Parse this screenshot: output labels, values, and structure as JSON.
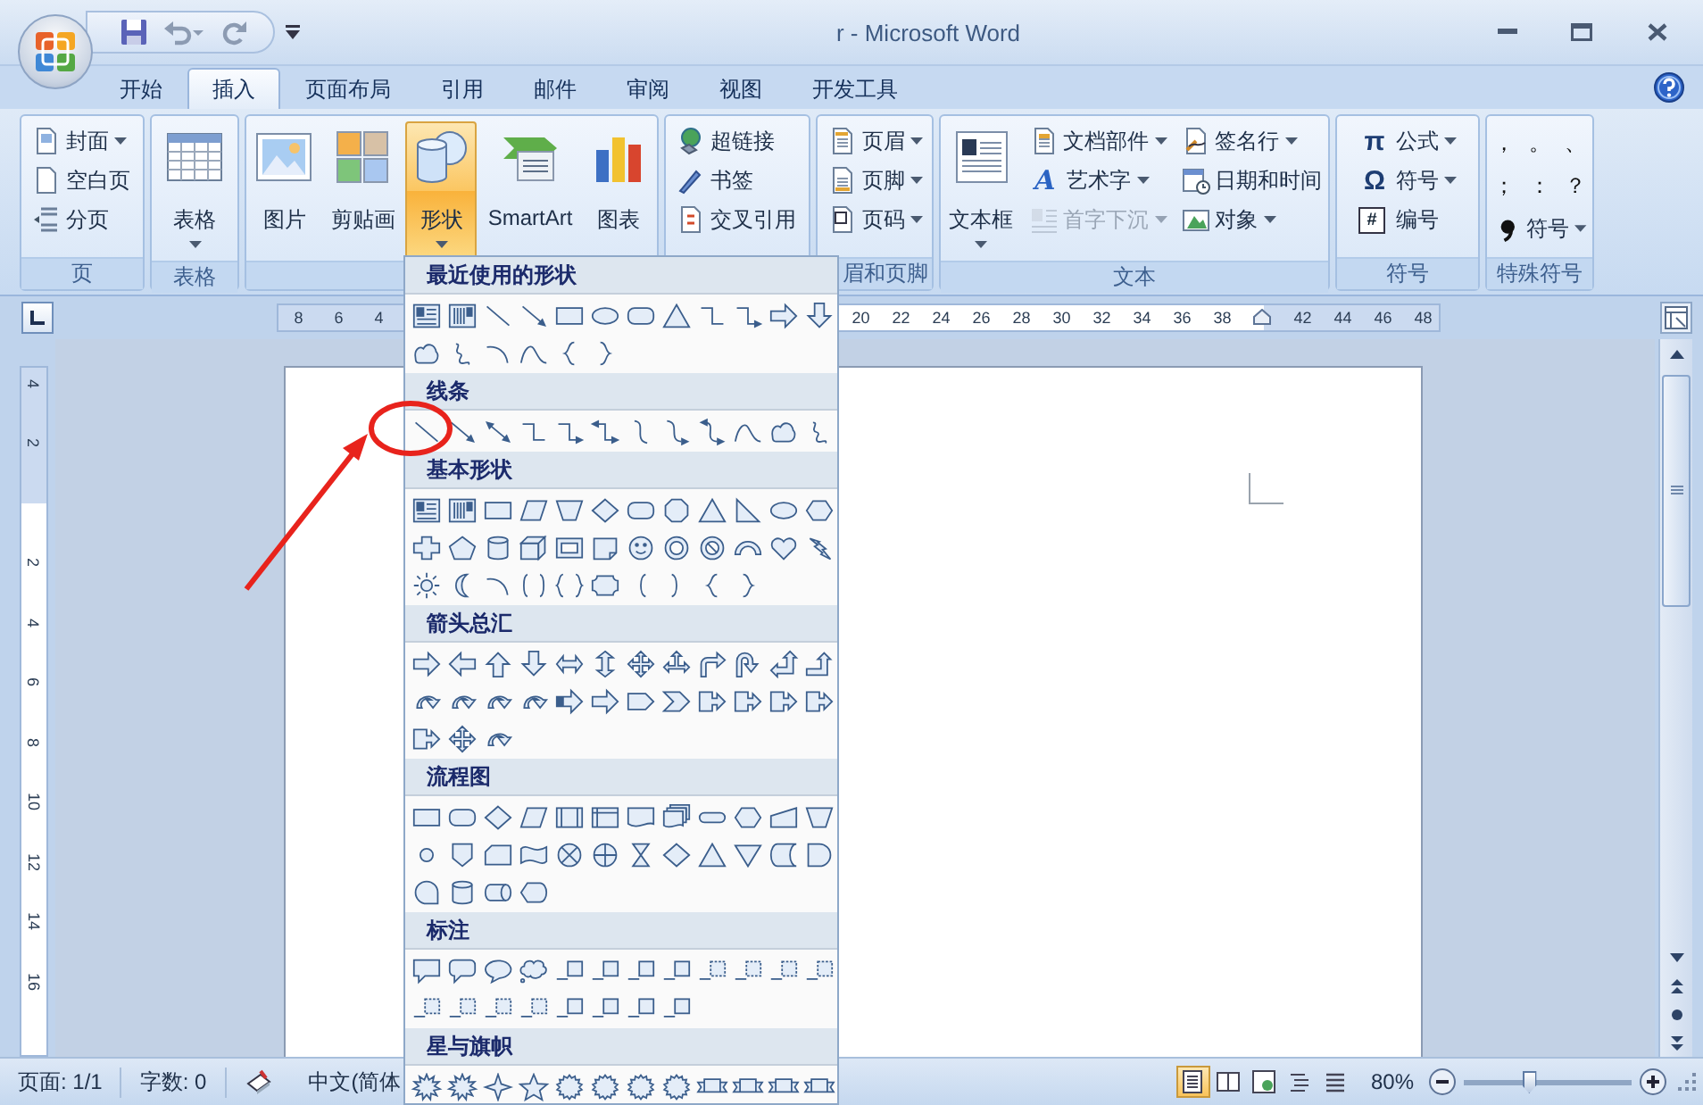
{
  "window": {
    "title": "r - Microsoft Word"
  },
  "tabs": [
    {
      "label": "开始",
      "selected": false
    },
    {
      "label": "插入",
      "selected": true
    },
    {
      "label": "页面布局",
      "selected": false
    },
    {
      "label": "引用",
      "selected": false
    },
    {
      "label": "邮件",
      "selected": false
    },
    {
      "label": "审阅",
      "selected": false
    },
    {
      "label": "视图",
      "selected": false
    },
    {
      "label": "开发工具",
      "selected": false
    }
  ],
  "ribbon": {
    "groups": [
      {
        "label": "页",
        "columns": [
          [
            {
              "kind": "small",
              "label": "封面",
              "dropdown": true,
              "disabled": false,
              "pressed": false
            },
            {
              "kind": "small",
              "label": "空白页",
              "dropdown": false,
              "disabled": false,
              "pressed": false
            },
            {
              "kind": "small",
              "label": "分页",
              "dropdown": false,
              "disabled": false,
              "pressed": false
            }
          ]
        ]
      },
      {
        "label": "表格",
        "columns": [
          [
            {
              "kind": "large",
              "label": "表格",
              "dropdown": true,
              "disabled": false,
              "pressed": false
            }
          ]
        ]
      },
      {
        "columns": [
          [
            {
              "kind": "large",
              "label": "图片",
              "dropdown": false,
              "disabled": false,
              "pressed": false
            }
          ],
          [
            {
              "kind": "large",
              "label": "剪贴画",
              "dropdown": false,
              "disabled": false,
              "pressed": false
            }
          ],
          [
            {
              "kind": "large",
              "label": "形状",
              "dropdown": true,
              "disabled": false,
              "pressed": true
            }
          ],
          [
            {
              "kind": "large",
              "label": "SmartArt",
              "dropdown": false,
              "disabled": false,
              "pressed": false
            }
          ],
          [
            {
              "kind": "large",
              "label": "图表",
              "dropdown": false,
              "disabled": false,
              "pressed": false
            }
          ]
        ]
      },
      {
        "columns": [
          [
            {
              "kind": "small",
              "label": "超链接",
              "dropdown": false,
              "disabled": false,
              "pressed": false
            },
            {
              "kind": "small",
              "label": "书签",
              "dropdown": false,
              "disabled": false,
              "pressed": false
            },
            {
              "kind": "small",
              "label": "交叉引用",
              "dropdown": false,
              "disabled": false,
              "pressed": false
            }
          ]
        ]
      },
      {
        "label": "眉和页脚",
        "columns": [
          [
            {
              "kind": "small",
              "label": "页眉",
              "dropdown": true,
              "disabled": false,
              "pressed": false
            },
            {
              "kind": "small",
              "label": "页脚",
              "dropdown": true,
              "disabled": false,
              "pressed": false
            },
            {
              "kind": "small",
              "label": "页码",
              "dropdown": true,
              "disabled": false,
              "pressed": false
            }
          ]
        ]
      },
      {
        "label": "文本",
        "columns": [
          [
            {
              "kind": "large",
              "label": "文本框",
              "dropdown": true,
              "disabled": false,
              "pressed": false
            }
          ],
          [
            {
              "kind": "small",
              "label": "文档部件",
              "dropdown": true,
              "disabled": false,
              "pressed": false
            },
            {
              "kind": "small",
              "label": "艺术字",
              "glyph": "A",
              "dropdown": true,
              "disabled": false,
              "pressed": false
            },
            {
              "kind": "small",
              "label": "首字下沉",
              "dropdown": true,
              "disabled": true,
              "pressed": false
            }
          ],
          [
            {
              "kind": "small",
              "label": "签名行",
              "dropdown": true,
              "disabled": false,
              "pressed": false
            },
            {
              "kind": "small",
              "label": "日期和时间",
              "dropdown": false,
              "disabled": false,
              "pressed": false
            },
            {
              "kind": "small",
              "label": "对象",
              "dropdown": true,
              "disabled": false,
              "pressed": false
            }
          ]
        ]
      },
      {
        "label": "符号",
        "columns": [
          [
            {
              "kind": "small",
              "label": "公式",
              "glyph": "π",
              "dropdown": true,
              "disabled": false,
              "pressed": false
            },
            {
              "kind": "small",
              "label": "符号",
              "glyph": "Ω",
              "dropdown": true,
              "disabled": false,
              "pressed": false
            },
            {
              "kind": "small",
              "label": "编号",
              "glyph": "#",
              "dropdown": false,
              "disabled": false,
              "pressed": false
            }
          ]
        ]
      },
      {
        "label": "特殊符号",
        "columns": [
          [
            {
              "kind": "char",
              "label": "，",
              "dropdown": false,
              "disabled": false,
              "pressed": false
            },
            {
              "kind": "char",
              "label": "。",
              "dropdown": false,
              "disabled": false,
              "pressed": false
            },
            {
              "kind": "char",
              "label": "、",
              "dropdown": false,
              "disabled": false,
              "pressed": false
            },
            {
              "kind": "char",
              "label": "；",
              "dropdown": false,
              "disabled": false,
              "pressed": false
            },
            {
              "kind": "char",
              "label": "：",
              "dropdown": false,
              "disabled": false,
              "pressed": false
            },
            {
              "kind": "char",
              "label": "？",
              "dropdown": false,
              "disabled": false,
              "pressed": false
            },
            {
              "kind": "small",
              "label": "符号",
              "dropdown": true,
              "disabled": false,
              "pressed": false
            }
          ]
        ]
      }
    ]
  },
  "ruler": {
    "left_numbers": [
      "8",
      "6",
      "4"
    ],
    "right_numbers": [
      "20",
      "22",
      "24",
      "26",
      "28",
      "30",
      "32",
      "34",
      "36",
      "38"
    ],
    "far_numbers": [
      "42",
      "44",
      "46",
      "48"
    ]
  },
  "vertical_ruler": {
    "top_numbers": [
      "4",
      "2"
    ],
    "bottom_numbers": [
      "2",
      "4",
      "6",
      "8",
      "10",
      "12",
      "14",
      "16"
    ]
  },
  "shapes_menu": {
    "sections": [
      {
        "title": "最近使用的形状",
        "shapes": [
          {
            "kind": "textbox"
          },
          {
            "kind": "vtextbox"
          },
          {
            "kind": "line"
          },
          {
            "kind": "arrow"
          },
          {
            "kind": "rect"
          },
          {
            "kind": "oval"
          },
          {
            "kind": "roundrect"
          },
          {
            "kind": "triangle"
          },
          {
            "kind": "elbow"
          },
          {
            "kind": "elbow-arrow"
          },
          {
            "kind": "rarrow"
          },
          {
            "kind": "darrow"
          },
          {
            "kind": "freeform"
          },
          {
            "kind": "scribble"
          },
          {
            "kind": "arc"
          },
          {
            "kind": "peak"
          },
          {
            "kind": "lbrace"
          },
          {
            "kind": "rbrace"
          }
        ]
      },
      {
        "title": "线条",
        "shapes": [
          {
            "kind": "line"
          },
          {
            "kind": "arrow"
          },
          {
            "kind": "dblarrow"
          },
          {
            "kind": "elbow"
          },
          {
            "kind": "elbow-arrow"
          },
          {
            "kind": "elbow-dblarrow"
          },
          {
            "kind": "curve"
          },
          {
            "kind": "curve-arrow"
          },
          {
            "kind": "curve-dblarrow"
          },
          {
            "kind": "peak"
          },
          {
            "kind": "freeform"
          },
          {
            "kind": "scribble"
          }
        ]
      },
      {
        "title": "基本形状",
        "shapes": [
          {
            "kind": "textbox"
          },
          {
            "kind": "vtextbox"
          },
          {
            "kind": "rect"
          },
          {
            "kind": "parallelogram"
          },
          {
            "kind": "trapezoid"
          },
          {
            "kind": "diamond"
          },
          {
            "kind": "roundrect"
          },
          {
            "kind": "octagon"
          },
          {
            "kind": "triangle"
          },
          {
            "kind": "rtriangle"
          },
          {
            "kind": "oval"
          },
          {
            "kind": "hexagon"
          },
          {
            "kind": "cross"
          },
          {
            "kind": "pentagon"
          },
          {
            "kind": "can"
          },
          {
            "kind": "cube"
          },
          {
            "kind": "frame"
          },
          {
            "kind": "folded"
          },
          {
            "kind": "smiley"
          },
          {
            "kind": "donut"
          },
          {
            "kind": "nosign"
          },
          {
            "kind": "blockarc"
          },
          {
            "kind": "heart"
          },
          {
            "kind": "lightning"
          },
          {
            "kind": "sun"
          },
          {
            "kind": "moon"
          },
          {
            "kind": "arc"
          },
          {
            "kind": "dbracket"
          },
          {
            "kind": "dbrace"
          },
          {
            "kind": "plaque"
          },
          {
            "kind": "lbracket"
          },
          {
            "kind": "rbracket"
          },
          {
            "kind": "lbrace"
          },
          {
            "kind": "rbrace"
          }
        ]
      },
      {
        "title": "箭头总汇",
        "shapes": [
          {
            "kind": "rarrow"
          },
          {
            "kind": "larrow"
          },
          {
            "kind": "uarrow"
          },
          {
            "kind": "darrow"
          },
          {
            "kind": "lrarrow"
          },
          {
            "kind": "udarrow"
          },
          {
            "kind": "quadarrow"
          },
          {
            "kind": "lrup-arrow"
          },
          {
            "kind": "bent-arrow"
          },
          {
            "kind": "uturn-arrow"
          },
          {
            "kind": "leftup-arrow"
          },
          {
            "kind": "bentup-arrow"
          },
          {
            "kind": "curved-arrow"
          },
          {
            "kind": "curved-arrow"
          },
          {
            "kind": "curved-arrow"
          },
          {
            "kind": "curved-arrow"
          },
          {
            "kind": "striped-arrow"
          },
          {
            "kind": "rarrow"
          },
          {
            "kind": "homeplate"
          },
          {
            "kind": "chevron"
          },
          {
            "kind": "callout-arrow"
          },
          {
            "kind": "callout-arrow"
          },
          {
            "kind": "callout-arrow"
          },
          {
            "kind": "callout-arrow"
          },
          {
            "kind": "callout-arrow"
          },
          {
            "kind": "quadarrow"
          },
          {
            "kind": "curved-arrow"
          }
        ]
      },
      {
        "title": "流程图",
        "shapes": [
          {
            "kind": "rect"
          },
          {
            "kind": "roundrect"
          },
          {
            "kind": "diamond"
          },
          {
            "kind": "parallelogram"
          },
          {
            "kind": "predefined"
          },
          {
            "kind": "internal-storage"
          },
          {
            "kind": "document"
          },
          {
            "kind": "multidoc"
          },
          {
            "kind": "terminator"
          },
          {
            "kind": "hexagon"
          },
          {
            "kind": "manual-input"
          },
          {
            "kind": "trapezoid"
          },
          {
            "kind": "connector"
          },
          {
            "kind": "offpage"
          },
          {
            "kind": "card"
          },
          {
            "kind": "tape"
          },
          {
            "kind": "sumjunction"
          },
          {
            "kind": "orsymbol"
          },
          {
            "kind": "collate"
          },
          {
            "kind": "diamond"
          },
          {
            "kind": "triangle"
          },
          {
            "kind": "merge"
          },
          {
            "kind": "stored-data"
          },
          {
            "kind": "delay"
          },
          {
            "kind": "sequential"
          },
          {
            "kind": "can"
          },
          {
            "kind": "direct-access"
          },
          {
            "kind": "display"
          }
        ]
      },
      {
        "title": "标注",
        "shapes": [
          {
            "kind": "callout-rect"
          },
          {
            "kind": "callout-round"
          },
          {
            "kind": "callout-oval"
          },
          {
            "kind": "callout-cloud"
          },
          {
            "kind": "line-callout"
          },
          {
            "kind": "line-callout"
          },
          {
            "kind": "line-callout"
          },
          {
            "kind": "line-callout"
          },
          {
            "kind": "dashed-callout"
          },
          {
            "kind": "dashed-callout"
          },
          {
            "kind": "dashed-callout"
          },
          {
            "kind": "dashed-callout"
          },
          {
            "kind": "dashed-callout"
          },
          {
            "kind": "dashed-callout"
          },
          {
            "kind": "dashed-callout"
          },
          {
            "kind": "dashed-callout"
          },
          {
            "kind": "line-callout"
          },
          {
            "kind": "line-callout"
          },
          {
            "kind": "line-callout"
          },
          {
            "kind": "line-callout"
          }
        ]
      },
      {
        "title": "星与旗帜",
        "shapes": [
          {
            "kind": "burst"
          },
          {
            "kind": "burst"
          },
          {
            "kind": "star4"
          },
          {
            "kind": "star5"
          },
          {
            "kind": "seal"
          },
          {
            "kind": "seal"
          },
          {
            "kind": "seal"
          },
          {
            "kind": "seal"
          },
          {
            "kind": "ribbon"
          },
          {
            "kind": "ribbon"
          },
          {
            "kind": "ribbon"
          },
          {
            "kind": "ribbon"
          }
        ]
      }
    ]
  },
  "status_bar": {
    "items": [
      {
        "kind": "text",
        "label": "页面: 1/1"
      },
      {
        "kind": "text",
        "label": "字数: 0"
      },
      {
        "kind": "proofing"
      },
      {
        "kind": "text",
        "label": "中文(简体"
      }
    ],
    "views": [
      {
        "selected": true
      },
      {
        "selected": false
      },
      {
        "selected": false
      },
      {
        "selected": false
      },
      {
        "selected": false
      }
    ],
    "zoom": {
      "reading": "80%",
      "level": 0.39
    }
  }
}
